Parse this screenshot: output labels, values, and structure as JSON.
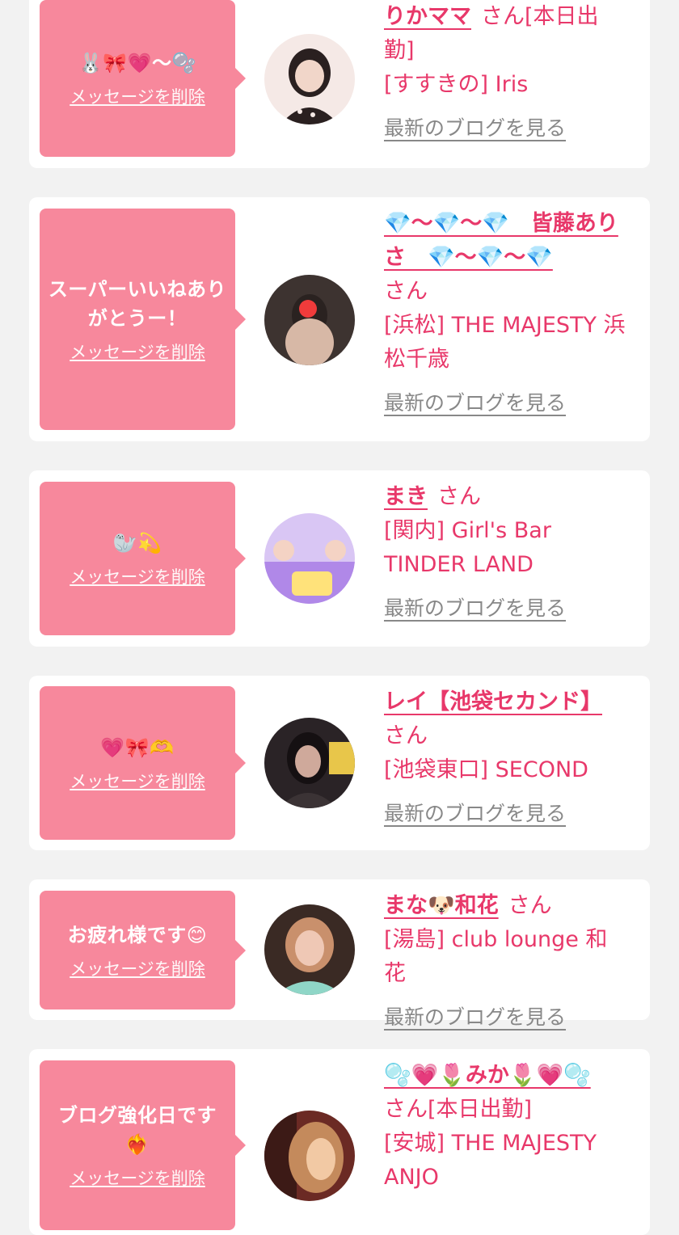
{
  "entries": [
    {
      "message": "🐰🎀💗〜🫧",
      "delete_label": "メッセージを削除",
      "name": "りかママ",
      "san": "さん",
      "status": "[本日出勤]",
      "store": "[すすきの] Iris",
      "blog_label": "最新のブログを見る",
      "avatar_colors": [
        "#f5e9e6",
        "#2a2020",
        "#e9d2c8"
      ]
    },
    {
      "message": "スーパーいいねありがとうー！",
      "delete_label": "メッセージを削除",
      "name": "💎〜💎〜💎　皆藤ありさ　💎〜💎〜💎",
      "san": "さん",
      "status": "",
      "store": "[浜松] THE MAJESTY 浜松千歳",
      "blog_label": "最新のブログを見る",
      "avatar_colors": [
        "#3d3330",
        "#d7b8a6",
        "#f03b3b"
      ]
    },
    {
      "message": "🦭💫",
      "delete_label": "メッセージを削除",
      "name": "まき",
      "san": "さん",
      "status": "",
      "store": "[関内] Girl's Bar TINDER LAND",
      "blog_label": "最新のブログを見る",
      "avatar_colors": [
        "#d9c6f4",
        "#ffe27a",
        "#b088e8"
      ]
    },
    {
      "message": "💗🎀🫶",
      "delete_label": "メッセージを削除",
      "name": "レイ【池袋セカンド】",
      "san": "さん",
      "status": "",
      "store": "[池袋東口] SECOND",
      "blog_label": "最新のブログを見る",
      "avatar_colors": [
        "#2a2326",
        "#cfa99b",
        "#e8c64a"
      ]
    },
    {
      "message": "お疲れ様です😊",
      "delete_label": "メッセージを削除",
      "name": "まな🐶和花",
      "san": "さん",
      "status": "",
      "store": "[湯島] club lounge 和花",
      "blog_label": "最新のブログを見る",
      "avatar_colors": [
        "#3a2a24",
        "#efc8b5",
        "#8fd6c7"
      ]
    },
    {
      "message": "ブログ強化日です❤️‍🔥",
      "delete_label": "メッセージを削除",
      "name": "🫧💗🌷みか🌷💗🫧",
      "san": "さん",
      "status": "[本日出勤]",
      "store": "[安城] THE MAJESTY ANJO",
      "blog_label": "最新のブログを見る",
      "avatar_colors": [
        "#6b2a24",
        "#c48a5c",
        "#f2c9a4"
      ]
    }
  ]
}
